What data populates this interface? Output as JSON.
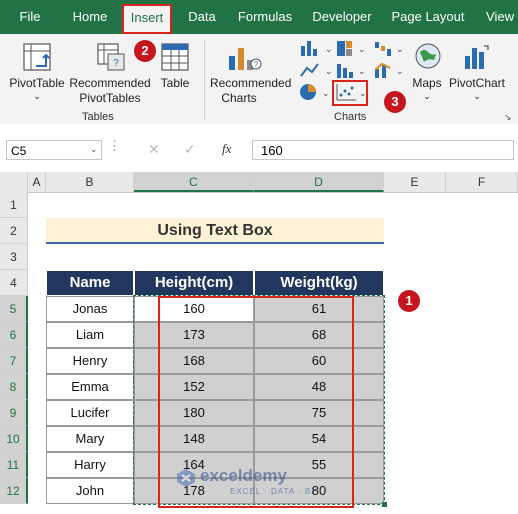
{
  "ribbon": {
    "tabs": [
      "File",
      "Home",
      "Insert",
      "Data",
      "Formulas",
      "Developer",
      "Page Layout",
      "View"
    ],
    "active_tab": "Insert",
    "buttons": {
      "pivottable": "PivotTable",
      "recommended_pivottables": "Recommended PivotTables",
      "table": "Table",
      "recommended_charts": "Recommended Charts",
      "maps": "Maps",
      "pivotchart": "PivotChart"
    },
    "groups": {
      "tables": "Tables",
      "charts": "Charts"
    }
  },
  "callouts": [
    "1",
    "2",
    "3"
  ],
  "formula_bar": {
    "name_box": "C5",
    "fx": "fx",
    "formula": "160"
  },
  "columns": [
    "A",
    "B",
    "C",
    "D",
    "E",
    "F"
  ],
  "rows": [
    "1",
    "2",
    "3",
    "4",
    "5",
    "6",
    "7",
    "8",
    "9",
    "10",
    "11",
    "12"
  ],
  "sheet": {
    "title": "Using Text Box",
    "headers": [
      "Name",
      "Height(cm)",
      "Weight(kg)"
    ],
    "data": [
      {
        "name": "Jonas",
        "height": "160",
        "weight": "61"
      },
      {
        "name": "Liam",
        "height": "173",
        "weight": "68"
      },
      {
        "name": "Henry",
        "height": "168",
        "weight": "60"
      },
      {
        "name": "Emma",
        "height": "152",
        "weight": "48"
      },
      {
        "name": "Lucifer",
        "height": "180",
        "weight": "75"
      },
      {
        "name": "Mary",
        "height": "148",
        "weight": "54"
      },
      {
        "name": "Harry",
        "height": "164",
        "weight": "55"
      },
      {
        "name": "John",
        "height": "178",
        "weight": "80"
      }
    ]
  },
  "watermark": {
    "brand": "exceldemy",
    "tagline": "EXCEL · DATA · BI"
  },
  "colors": {
    "excel_green": "#217346",
    "header_navy": "#22375f",
    "title_fill": "#fdf1d6",
    "callout_red": "#c4161c",
    "selection_gray": "#d0d0d0"
  }
}
